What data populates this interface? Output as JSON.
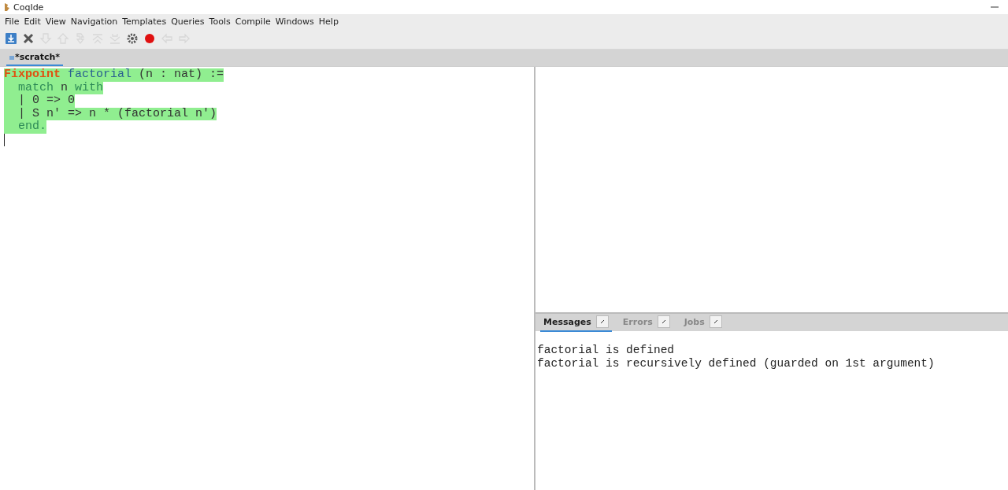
{
  "window": {
    "title": "CoqIde"
  },
  "menu": [
    "File",
    "Edit",
    "View",
    "Navigation",
    "Templates",
    "Queries",
    "Tools",
    "Compile",
    "Windows",
    "Help"
  ],
  "toolbar": [
    {
      "kind": "save",
      "disabled": false
    },
    {
      "kind": "close",
      "disabled": false
    },
    {
      "kind": "down",
      "disabled": true
    },
    {
      "kind": "up",
      "disabled": true
    },
    {
      "kind": "cursor",
      "disabled": true
    },
    {
      "kind": "top",
      "disabled": true
    },
    {
      "kind": "bottom",
      "disabled": true
    },
    {
      "kind": "gear",
      "disabled": false
    },
    {
      "kind": "stop",
      "disabled": false
    },
    {
      "kind": "back",
      "disabled": true
    },
    {
      "kind": "forward",
      "disabled": true
    }
  ],
  "tabs": [
    {
      "label": "*scratch*",
      "selected": true
    }
  ],
  "editor": {
    "lines": [
      {
        "processed": true,
        "segments": [
          {
            "kind": "keyword",
            "text": "Fixpoint"
          },
          {
            "kind": "name",
            "text": " factorial"
          },
          {
            "kind": "plain",
            "text": " (n : nat) :="
          }
        ]
      },
      {
        "processed": true,
        "segments": [
          {
            "kind": "tactic",
            "text": "  match"
          },
          {
            "kind": "plain",
            "text": " n "
          },
          {
            "kind": "tactic",
            "text": "with"
          }
        ]
      },
      {
        "processed": true,
        "segments": [
          {
            "kind": "plain",
            "text": "  | 0 => 0"
          }
        ]
      },
      {
        "processed": true,
        "segments": [
          {
            "kind": "plain",
            "text": "  | S n' => n * (factorial n')"
          }
        ]
      },
      {
        "processed": true,
        "segments": [
          {
            "kind": "tactic",
            "text": "  end."
          }
        ]
      }
    ]
  },
  "message_tabs": [
    {
      "label": "Messages",
      "selected": true
    },
    {
      "label": "Errors",
      "selected": false
    },
    {
      "label": "Jobs",
      "selected": false
    }
  ],
  "messages": [
    "factorial is defined",
    "factorial is recursively defined (guarded on 1st argument)"
  ]
}
